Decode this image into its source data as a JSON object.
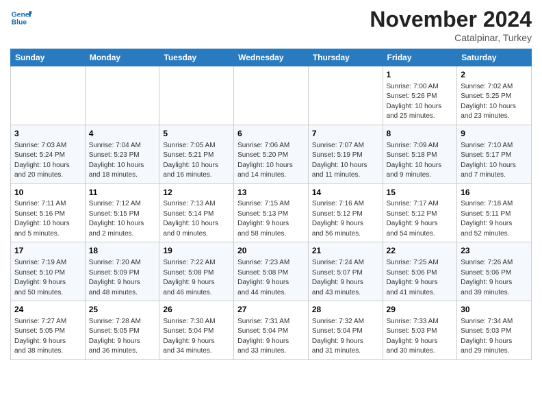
{
  "header": {
    "logo_line1": "General",
    "logo_line2": "Blue",
    "month_title": "November 2024",
    "location": "Catalpinar, Turkey"
  },
  "days_of_week": [
    "Sunday",
    "Monday",
    "Tuesday",
    "Wednesday",
    "Thursday",
    "Friday",
    "Saturday"
  ],
  "weeks": [
    [
      {
        "day": "",
        "info": ""
      },
      {
        "day": "",
        "info": ""
      },
      {
        "day": "",
        "info": ""
      },
      {
        "day": "",
        "info": ""
      },
      {
        "day": "",
        "info": ""
      },
      {
        "day": "1",
        "info": "Sunrise: 7:00 AM\nSunset: 5:26 PM\nDaylight: 10 hours\nand 25 minutes."
      },
      {
        "day": "2",
        "info": "Sunrise: 7:02 AM\nSunset: 5:25 PM\nDaylight: 10 hours\nand 23 minutes."
      }
    ],
    [
      {
        "day": "3",
        "info": "Sunrise: 7:03 AM\nSunset: 5:24 PM\nDaylight: 10 hours\nand 20 minutes."
      },
      {
        "day": "4",
        "info": "Sunrise: 7:04 AM\nSunset: 5:23 PM\nDaylight: 10 hours\nand 18 minutes."
      },
      {
        "day": "5",
        "info": "Sunrise: 7:05 AM\nSunset: 5:21 PM\nDaylight: 10 hours\nand 16 minutes."
      },
      {
        "day": "6",
        "info": "Sunrise: 7:06 AM\nSunset: 5:20 PM\nDaylight: 10 hours\nand 14 minutes."
      },
      {
        "day": "7",
        "info": "Sunrise: 7:07 AM\nSunset: 5:19 PM\nDaylight: 10 hours\nand 11 minutes."
      },
      {
        "day": "8",
        "info": "Sunrise: 7:09 AM\nSunset: 5:18 PM\nDaylight: 10 hours\nand 9 minutes."
      },
      {
        "day": "9",
        "info": "Sunrise: 7:10 AM\nSunset: 5:17 PM\nDaylight: 10 hours\nand 7 minutes."
      }
    ],
    [
      {
        "day": "10",
        "info": "Sunrise: 7:11 AM\nSunset: 5:16 PM\nDaylight: 10 hours\nand 5 minutes."
      },
      {
        "day": "11",
        "info": "Sunrise: 7:12 AM\nSunset: 5:15 PM\nDaylight: 10 hours\nand 2 minutes."
      },
      {
        "day": "12",
        "info": "Sunrise: 7:13 AM\nSunset: 5:14 PM\nDaylight: 10 hours\nand 0 minutes."
      },
      {
        "day": "13",
        "info": "Sunrise: 7:15 AM\nSunset: 5:13 PM\nDaylight: 9 hours\nand 58 minutes."
      },
      {
        "day": "14",
        "info": "Sunrise: 7:16 AM\nSunset: 5:12 PM\nDaylight: 9 hours\nand 56 minutes."
      },
      {
        "day": "15",
        "info": "Sunrise: 7:17 AM\nSunset: 5:12 PM\nDaylight: 9 hours\nand 54 minutes."
      },
      {
        "day": "16",
        "info": "Sunrise: 7:18 AM\nSunset: 5:11 PM\nDaylight: 9 hours\nand 52 minutes."
      }
    ],
    [
      {
        "day": "17",
        "info": "Sunrise: 7:19 AM\nSunset: 5:10 PM\nDaylight: 9 hours\nand 50 minutes."
      },
      {
        "day": "18",
        "info": "Sunrise: 7:20 AM\nSunset: 5:09 PM\nDaylight: 9 hours\nand 48 minutes."
      },
      {
        "day": "19",
        "info": "Sunrise: 7:22 AM\nSunset: 5:08 PM\nDaylight: 9 hours\nand 46 minutes."
      },
      {
        "day": "20",
        "info": "Sunrise: 7:23 AM\nSunset: 5:08 PM\nDaylight: 9 hours\nand 44 minutes."
      },
      {
        "day": "21",
        "info": "Sunrise: 7:24 AM\nSunset: 5:07 PM\nDaylight: 9 hours\nand 43 minutes."
      },
      {
        "day": "22",
        "info": "Sunrise: 7:25 AM\nSunset: 5:06 PM\nDaylight: 9 hours\nand 41 minutes."
      },
      {
        "day": "23",
        "info": "Sunrise: 7:26 AM\nSunset: 5:06 PM\nDaylight: 9 hours\nand 39 minutes."
      }
    ],
    [
      {
        "day": "24",
        "info": "Sunrise: 7:27 AM\nSunset: 5:05 PM\nDaylight: 9 hours\nand 38 minutes."
      },
      {
        "day": "25",
        "info": "Sunrise: 7:28 AM\nSunset: 5:05 PM\nDaylight: 9 hours\nand 36 minutes."
      },
      {
        "day": "26",
        "info": "Sunrise: 7:30 AM\nSunset: 5:04 PM\nDaylight: 9 hours\nand 34 minutes."
      },
      {
        "day": "27",
        "info": "Sunrise: 7:31 AM\nSunset: 5:04 PM\nDaylight: 9 hours\nand 33 minutes."
      },
      {
        "day": "28",
        "info": "Sunrise: 7:32 AM\nSunset: 5:04 PM\nDaylight: 9 hours\nand 31 minutes."
      },
      {
        "day": "29",
        "info": "Sunrise: 7:33 AM\nSunset: 5:03 PM\nDaylight: 9 hours\nand 30 minutes."
      },
      {
        "day": "30",
        "info": "Sunrise: 7:34 AM\nSunset: 5:03 PM\nDaylight: 9 hours\nand 29 minutes."
      }
    ]
  ]
}
